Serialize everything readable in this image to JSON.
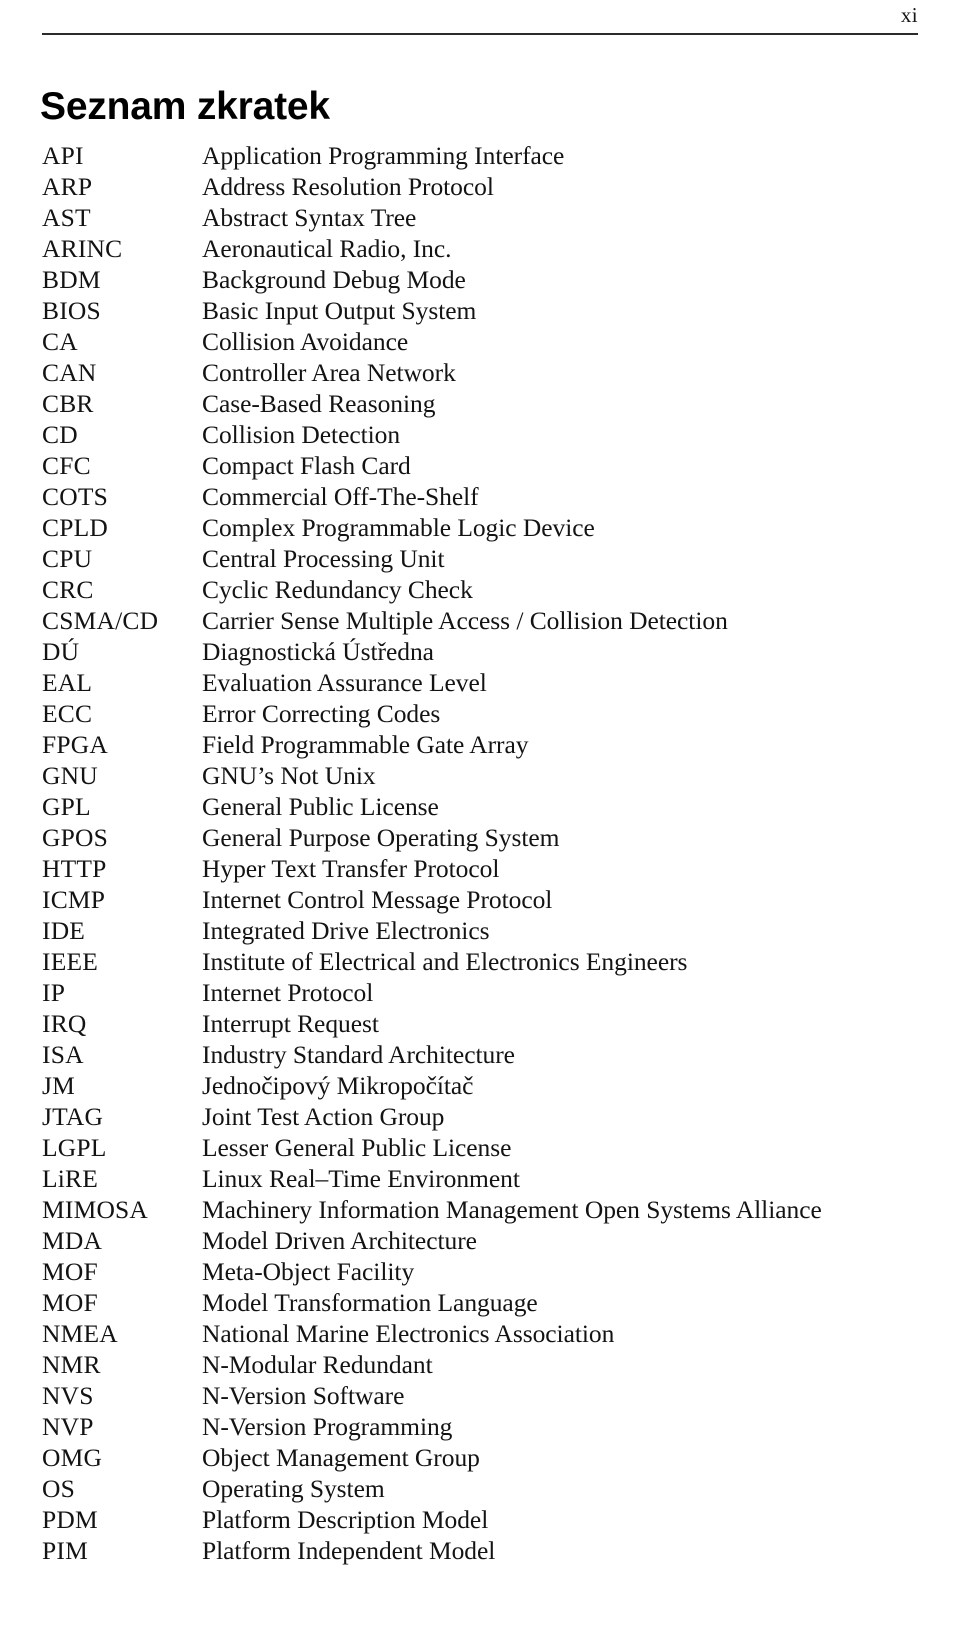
{
  "header": {
    "folio": "xi"
  },
  "title": "Seznam zkratek",
  "abbreviations": [
    {
      "term": "API",
      "definition": "Application Programming Interface"
    },
    {
      "term": "ARP",
      "definition": "Address Resolution Protocol"
    },
    {
      "term": "AST",
      "definition": "Abstract Syntax Tree"
    },
    {
      "term": "ARINC",
      "definition": "Aeronautical Radio, Inc."
    },
    {
      "term": "BDM",
      "definition": "Background Debug Mode"
    },
    {
      "term": "BIOS",
      "definition": "Basic Input Output System"
    },
    {
      "term": "CA",
      "definition": "Collision Avoidance"
    },
    {
      "term": "CAN",
      "definition": "Controller Area Network"
    },
    {
      "term": "CBR",
      "definition": "Case-Based Reasoning"
    },
    {
      "term": "CD",
      "definition": "Collision Detection"
    },
    {
      "term": "CFC",
      "definition": "Compact Flash Card"
    },
    {
      "term": "COTS",
      "definition": "Commercial Off-The-Shelf"
    },
    {
      "term": "CPLD",
      "definition": "Complex Programmable Logic Device"
    },
    {
      "term": "CPU",
      "definition": "Central Processing Unit"
    },
    {
      "term": "CRC",
      "definition": "Cyclic Redundancy Check"
    },
    {
      "term": "CSMA/CD",
      "definition": "Carrier Sense Multiple Access / Collision Detection"
    },
    {
      "term": "DÚ",
      "definition": "Diagnostická Ústředna"
    },
    {
      "term": "EAL",
      "definition": "Evaluation Assurance Level"
    },
    {
      "term": "ECC",
      "definition": "Error Correcting Codes"
    },
    {
      "term": "FPGA",
      "definition": "Field Programmable Gate Array"
    },
    {
      "term": "GNU",
      "definition": "GNU’s Not Unix"
    },
    {
      "term": "GPL",
      "definition": "General Public License"
    },
    {
      "term": "GPOS",
      "definition": "General Purpose Operating System"
    },
    {
      "term": "HTTP",
      "definition": "Hyper Text Transfer Protocol"
    },
    {
      "term": "ICMP",
      "definition": "Internet Control Message Protocol"
    },
    {
      "term": "IDE",
      "definition": "Integrated Drive Electronics"
    },
    {
      "term": "IEEE",
      "definition": "Institute of Electrical and Electronics Engineers"
    },
    {
      "term": "IP",
      "definition": "Internet Protocol"
    },
    {
      "term": "IRQ",
      "definition": "Interrupt Request"
    },
    {
      "term": "ISA",
      "definition": "Industry Standard Architecture"
    },
    {
      "term": "JM",
      "definition": "Jednočipový Mikropočítač"
    },
    {
      "term": "JTAG",
      "definition": "Joint Test Action Group"
    },
    {
      "term": "LGPL",
      "definition": "Lesser General Public License"
    },
    {
      "term": "LiRE",
      "definition": "Linux Real–Time Environment"
    },
    {
      "term": "MIMOSA",
      "definition": "Machinery Information Management Open Systems Alliance"
    },
    {
      "term": "MDA",
      "definition": "Model Driven Architecture"
    },
    {
      "term": "MOF",
      "definition": "Meta-Object Facility"
    },
    {
      "term": "MOF",
      "definition": "Model Transformation Language"
    },
    {
      "term": "NMEA",
      "definition": "National Marine Electronics Association"
    },
    {
      "term": "NMR",
      "definition": "N-Modular Redundant"
    },
    {
      "term": "NVS",
      "definition": "N-Version Software"
    },
    {
      "term": "NVP",
      "definition": "N-Version Programming"
    },
    {
      "term": "OMG",
      "definition": "Object Management Group"
    },
    {
      "term": "OS",
      "definition": "Operating System"
    },
    {
      "term": "PDM",
      "definition": "Platform Description Model"
    },
    {
      "term": "PIM",
      "definition": "Platform Independent Model"
    }
  ]
}
